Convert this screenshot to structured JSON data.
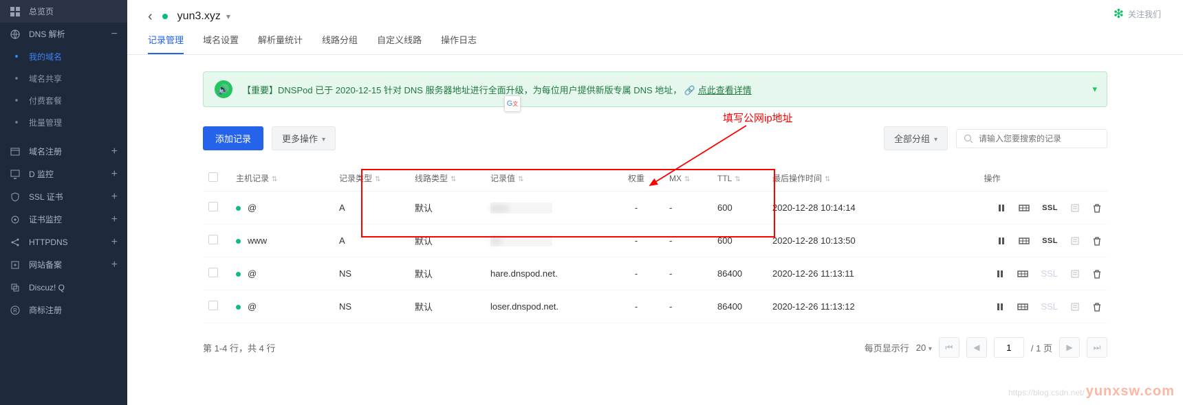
{
  "sidebar": {
    "items": [
      {
        "label": "总览页"
      },
      {
        "label": "DNS 解析"
      },
      {
        "label": "域名注册"
      },
      {
        "label": "D 监控"
      },
      {
        "label": "SSL 证书"
      },
      {
        "label": "证书监控"
      },
      {
        "label": "HTTPDNS"
      },
      {
        "label": "网站备案"
      },
      {
        "label": "Discuz! Q"
      },
      {
        "label": "商标注册"
      }
    ],
    "subs": [
      "我的域名",
      "域名共享",
      "付费套餐",
      "批量管理"
    ]
  },
  "breadcrumb": {
    "title": "yun3.xyz"
  },
  "tabs": [
    "记录管理",
    "域名设置",
    "解析量统计",
    "线路分组",
    "自定义线路",
    "操作日志"
  ],
  "notice": {
    "text": "【重要】DNSPod 已于 2020-12-15 针对 DNS 服务器地址进行全面升级，为每位用户提供新版专属 DNS 地址，",
    "link": "点此查看详情"
  },
  "toolbar": {
    "add": "添加记录",
    "more": "更多操作",
    "group_filter": "全部分组",
    "search_placeholder": "请输入您要搜索的记录"
  },
  "annotation": "填写公网ip地址",
  "table": {
    "headers": [
      "主机记录",
      "记录类型",
      "线路类型",
      "记录值",
      "权重",
      "MX",
      "TTL",
      "最后操作时间",
      "操作"
    ],
    "rows": [
      {
        "host": "@",
        "type": "A",
        "line": "默认",
        "value": "",
        "value_blur": true,
        "weight": "-",
        "mx": "-",
        "ttl": "600",
        "time": "2020-12-28 10:14:14",
        "ssl": true
      },
      {
        "host": "www",
        "type": "A",
        "line": "默认",
        "value": "14",
        "value_blur": true,
        "weight": "-",
        "mx": "-",
        "ttl": "600",
        "time": "2020-12-28 10:13:50",
        "ssl": true
      },
      {
        "host": "@",
        "type": "NS",
        "line": "默认",
        "value": "hare.dnspod.net.",
        "value_blur": false,
        "weight": "-",
        "mx": "-",
        "ttl": "86400",
        "time": "2020-12-26 11:13:11",
        "ssl": false
      },
      {
        "host": "@",
        "type": "NS",
        "line": "默认",
        "value": "loser.dnspod.net.",
        "value_blur": false,
        "weight": "-",
        "mx": "-",
        "ttl": "86400",
        "time": "2020-12-26 11:13:12",
        "ssl": false
      }
    ]
  },
  "pager": {
    "info": "第 1-4 行，共 4 行",
    "per_page_label": "每页显示行",
    "per_page": "20",
    "current": "1",
    "total_label": "/ 1 页"
  },
  "wechat": "关注我们",
  "watermark": {
    "faint": "https://blog.csdn.net/",
    "main": "yunxsw.com"
  }
}
